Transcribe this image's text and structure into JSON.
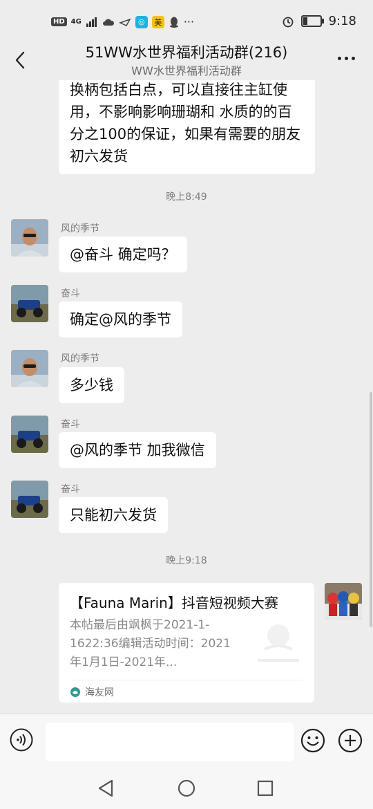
{
  "status_bar": {
    "hd": "HD",
    "network": "4G",
    "app_badge": "美",
    "time": "9:18"
  },
  "header": {
    "title": "51WW水世界福利活动群(216)",
    "subtitle": "WW水世界福利活动群"
  },
  "messages": {
    "m0_text": "换柄包括白点，可以直接往主缸使用，不影响影响珊瑚和 水质的的百分之100的保证，如果有需要的朋友初六发货",
    "time1": "晚上8:49",
    "m1_name": "风的季节",
    "m1_text": "@奋斗  确定吗？",
    "m2_name": "奋斗",
    "m2_text": "确定@风的季节",
    "m3_name": "风的季节",
    "m3_text": "多少钱",
    "m4_name": "奋斗",
    "m4_text": "@风的季节  加我微信",
    "m5_name": "奋斗",
    "m5_text": "只能初六发货",
    "time2": "晚上9:18"
  },
  "link_card": {
    "title": "【Fauna Marin】抖音短视频大赛",
    "description": "本帖最后由飒枫于2021-1-1622:36编辑活动时间：2021年1月1日-2021年...",
    "source": "海友网"
  },
  "colors": {
    "bg": "#ededed",
    "bubble": "#ffffff",
    "meta": "#7e7e7e"
  }
}
